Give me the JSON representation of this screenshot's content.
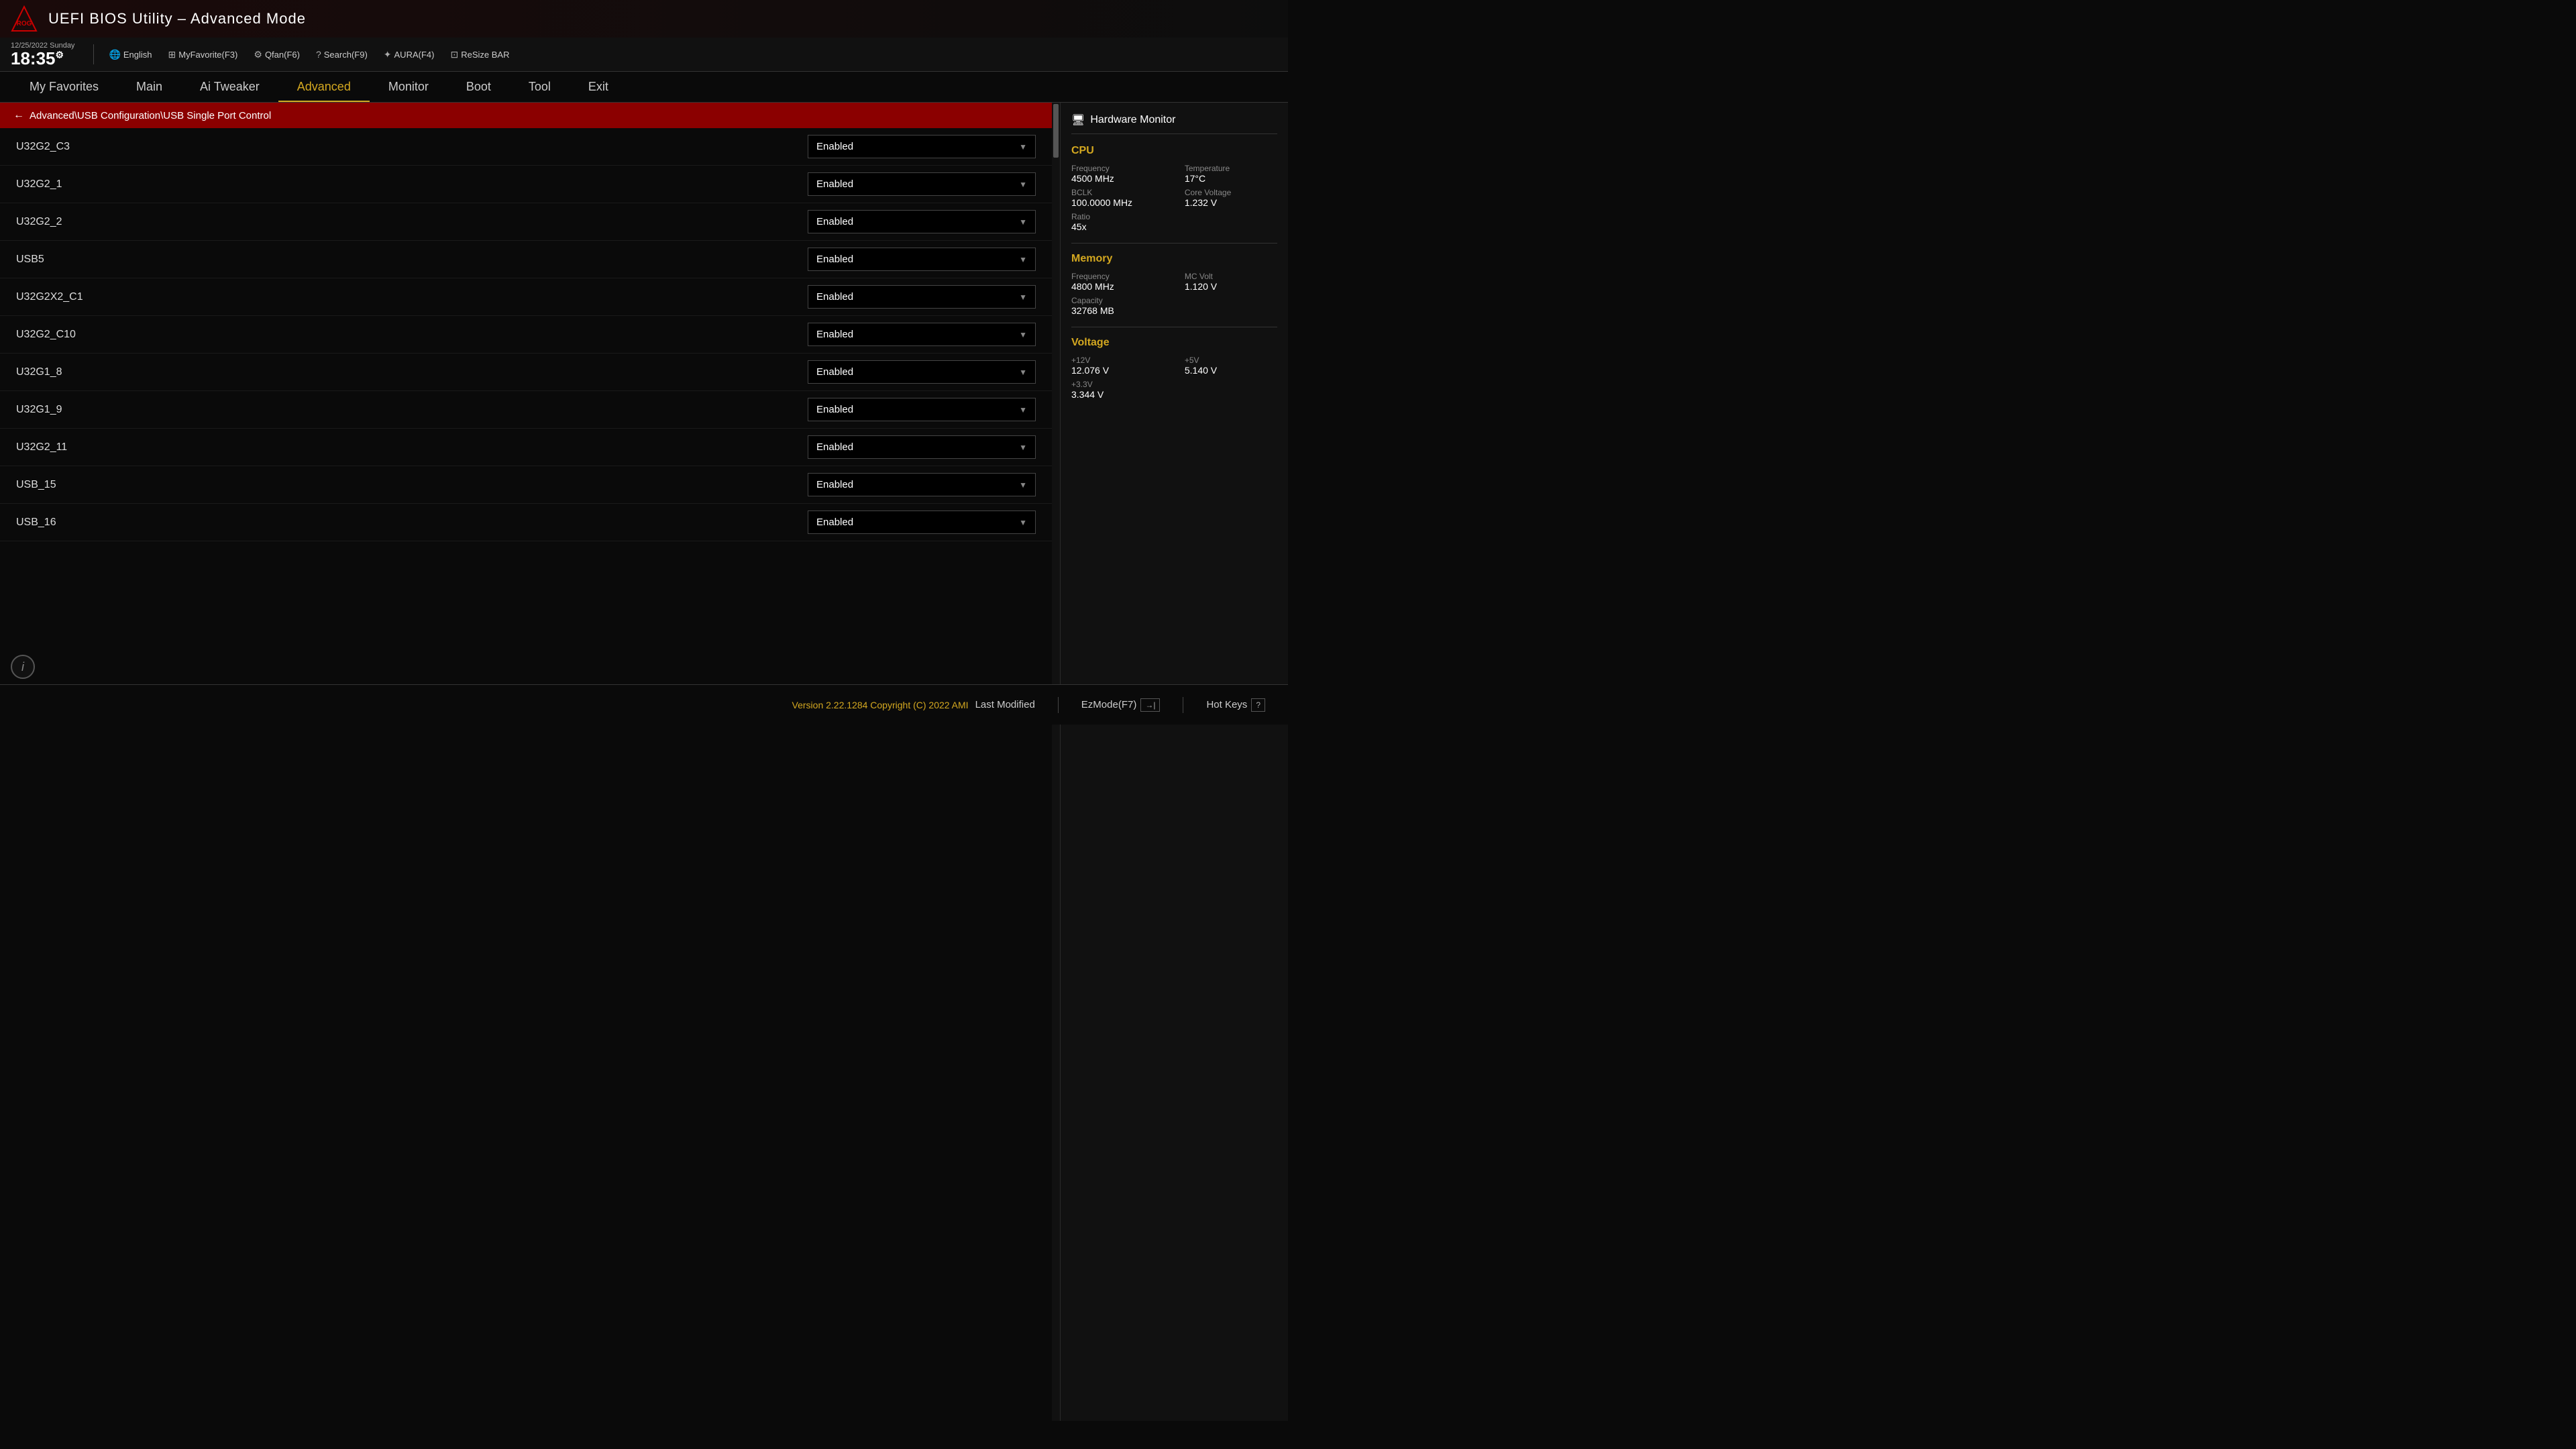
{
  "app": {
    "title": "UEFI BIOS Utility – Advanced Mode",
    "logo_alt": "ROG Logo"
  },
  "datetime": {
    "date": "12/25/2022",
    "day": "Sunday",
    "time": "18:35"
  },
  "toolbar": {
    "language": "English",
    "myfavorite": "MyFavorite(F3)",
    "qfan": "Qfan(F6)",
    "search": "Search(F9)",
    "aura": "AURA(F4)",
    "resize": "ReSize BAR"
  },
  "nav": {
    "items": [
      {
        "id": "my-favorites",
        "label": "My Favorites",
        "active": false
      },
      {
        "id": "main",
        "label": "Main",
        "active": false
      },
      {
        "id": "ai-tweaker",
        "label": "Ai Tweaker",
        "active": false
      },
      {
        "id": "advanced",
        "label": "Advanced",
        "active": true
      },
      {
        "id": "monitor",
        "label": "Monitor",
        "active": false
      },
      {
        "id": "boot",
        "label": "Boot",
        "active": false
      },
      {
        "id": "tool",
        "label": "Tool",
        "active": false
      },
      {
        "id": "exit",
        "label": "Exit",
        "active": false
      }
    ]
  },
  "breadcrumb": {
    "arrow": "←",
    "path": "Advanced\\USB Configuration\\USB Single Port Control"
  },
  "settings": [
    {
      "label": "U32G2_C3",
      "value": "Enabled"
    },
    {
      "label": "U32G2_1",
      "value": "Enabled"
    },
    {
      "label": "U32G2_2",
      "value": "Enabled"
    },
    {
      "label": "USB5",
      "value": "Enabled"
    },
    {
      "label": "U32G2X2_C1",
      "value": "Enabled"
    },
    {
      "label": "U32G2_C10",
      "value": "Enabled"
    },
    {
      "label": "U32G1_8",
      "value": "Enabled"
    },
    {
      "label": "U32G1_9",
      "value": "Enabled"
    },
    {
      "label": "U32G2_11",
      "value": "Enabled"
    },
    {
      "label": "USB_15",
      "value": "Enabled"
    },
    {
      "label": "USB_16",
      "value": "Enabled"
    }
  ],
  "hw_monitor": {
    "title": "Hardware Monitor",
    "sections": {
      "cpu": {
        "title": "CPU",
        "frequency_label": "Frequency",
        "frequency_val": "4500 MHz",
        "temperature_label": "Temperature",
        "temperature_val": "17°C",
        "bclk_label": "BCLK",
        "bclk_val": "100.0000 MHz",
        "core_voltage_label": "Core Voltage",
        "core_voltage_val": "1.232 V",
        "ratio_label": "Ratio",
        "ratio_val": "45x"
      },
      "memory": {
        "title": "Memory",
        "frequency_label": "Frequency",
        "frequency_val": "4800 MHz",
        "mc_volt_label": "MC Volt",
        "mc_volt_val": "1.120 V",
        "capacity_label": "Capacity",
        "capacity_val": "32768 MB"
      },
      "voltage": {
        "title": "Voltage",
        "v12_label": "+12V",
        "v12_val": "12.076 V",
        "v5_label": "+5V",
        "v5_val": "5.140 V",
        "v33_label": "+3.3V",
        "v33_val": "3.344 V"
      }
    }
  },
  "footer": {
    "version": "Version 2.22.1284 Copyright (C) 2022 AMI",
    "last_modified": "Last Modified",
    "ez_mode": "EzMode(F7)",
    "hot_keys": "Hot Keys"
  }
}
